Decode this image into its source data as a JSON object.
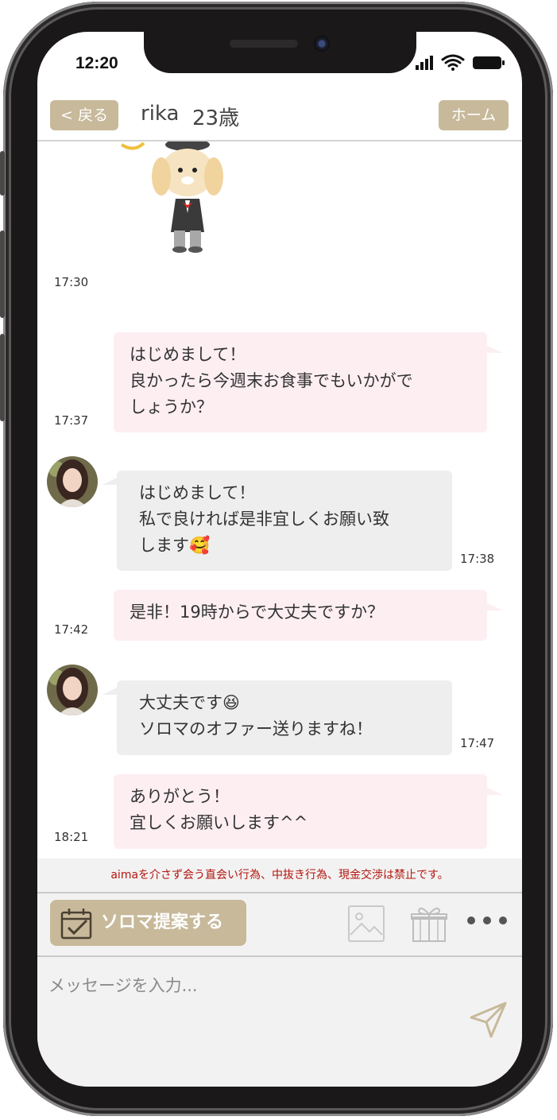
{
  "status_bar": {
    "time": "12:20"
  },
  "header": {
    "back_label": "< 戻る",
    "name": "rika",
    "age": "23歳",
    "home_label": "ホーム"
  },
  "messages": [
    {
      "type": "sticker",
      "side": "out",
      "time": "17:30",
      "sticker": "dog-gentleman-sticker"
    },
    {
      "type": "text",
      "side": "out",
      "time": "17:37",
      "lines": [
        "はじめまして！",
        "良かったら今週末お食事でもいかがで",
        "しょうか？"
      ]
    },
    {
      "type": "text",
      "side": "in",
      "time": "17:38",
      "lines": [
        "はじめまして！",
        "私で良ければ是非宜しくお願い致",
        "します🥰"
      ]
    },
    {
      "type": "text",
      "side": "out",
      "time": "17:42",
      "lines": [
        "是非！19時からで大丈夫ですか？"
      ]
    },
    {
      "type": "text",
      "side": "in",
      "time": "17:47",
      "lines": [
        "大丈夫です😆",
        "ソロマのオファー送りますね！"
      ]
    },
    {
      "type": "text",
      "side": "out",
      "time": "18:21",
      "lines": [
        "ありがとう！",
        "宜しくお願いします^^"
      ]
    }
  ],
  "notice": "aimaを介さず会う直会い行為、中抜き行為、現金交渉は禁止です。",
  "toolbar": {
    "soroma_label": "ソロマ提案する"
  },
  "composer": {
    "placeholder": "メッセージを入力..."
  },
  "colors": {
    "accent": "#c7b99a",
    "outgoing_bubble": "#fdeef2",
    "incoming_bubble": "#eeeeee",
    "notice_text": "#b2160f"
  },
  "icons": [
    "signal-icon",
    "wifi-icon",
    "battery-icon",
    "calendar-check-icon",
    "image-icon",
    "gift-icon",
    "more-icon",
    "send-icon"
  ]
}
